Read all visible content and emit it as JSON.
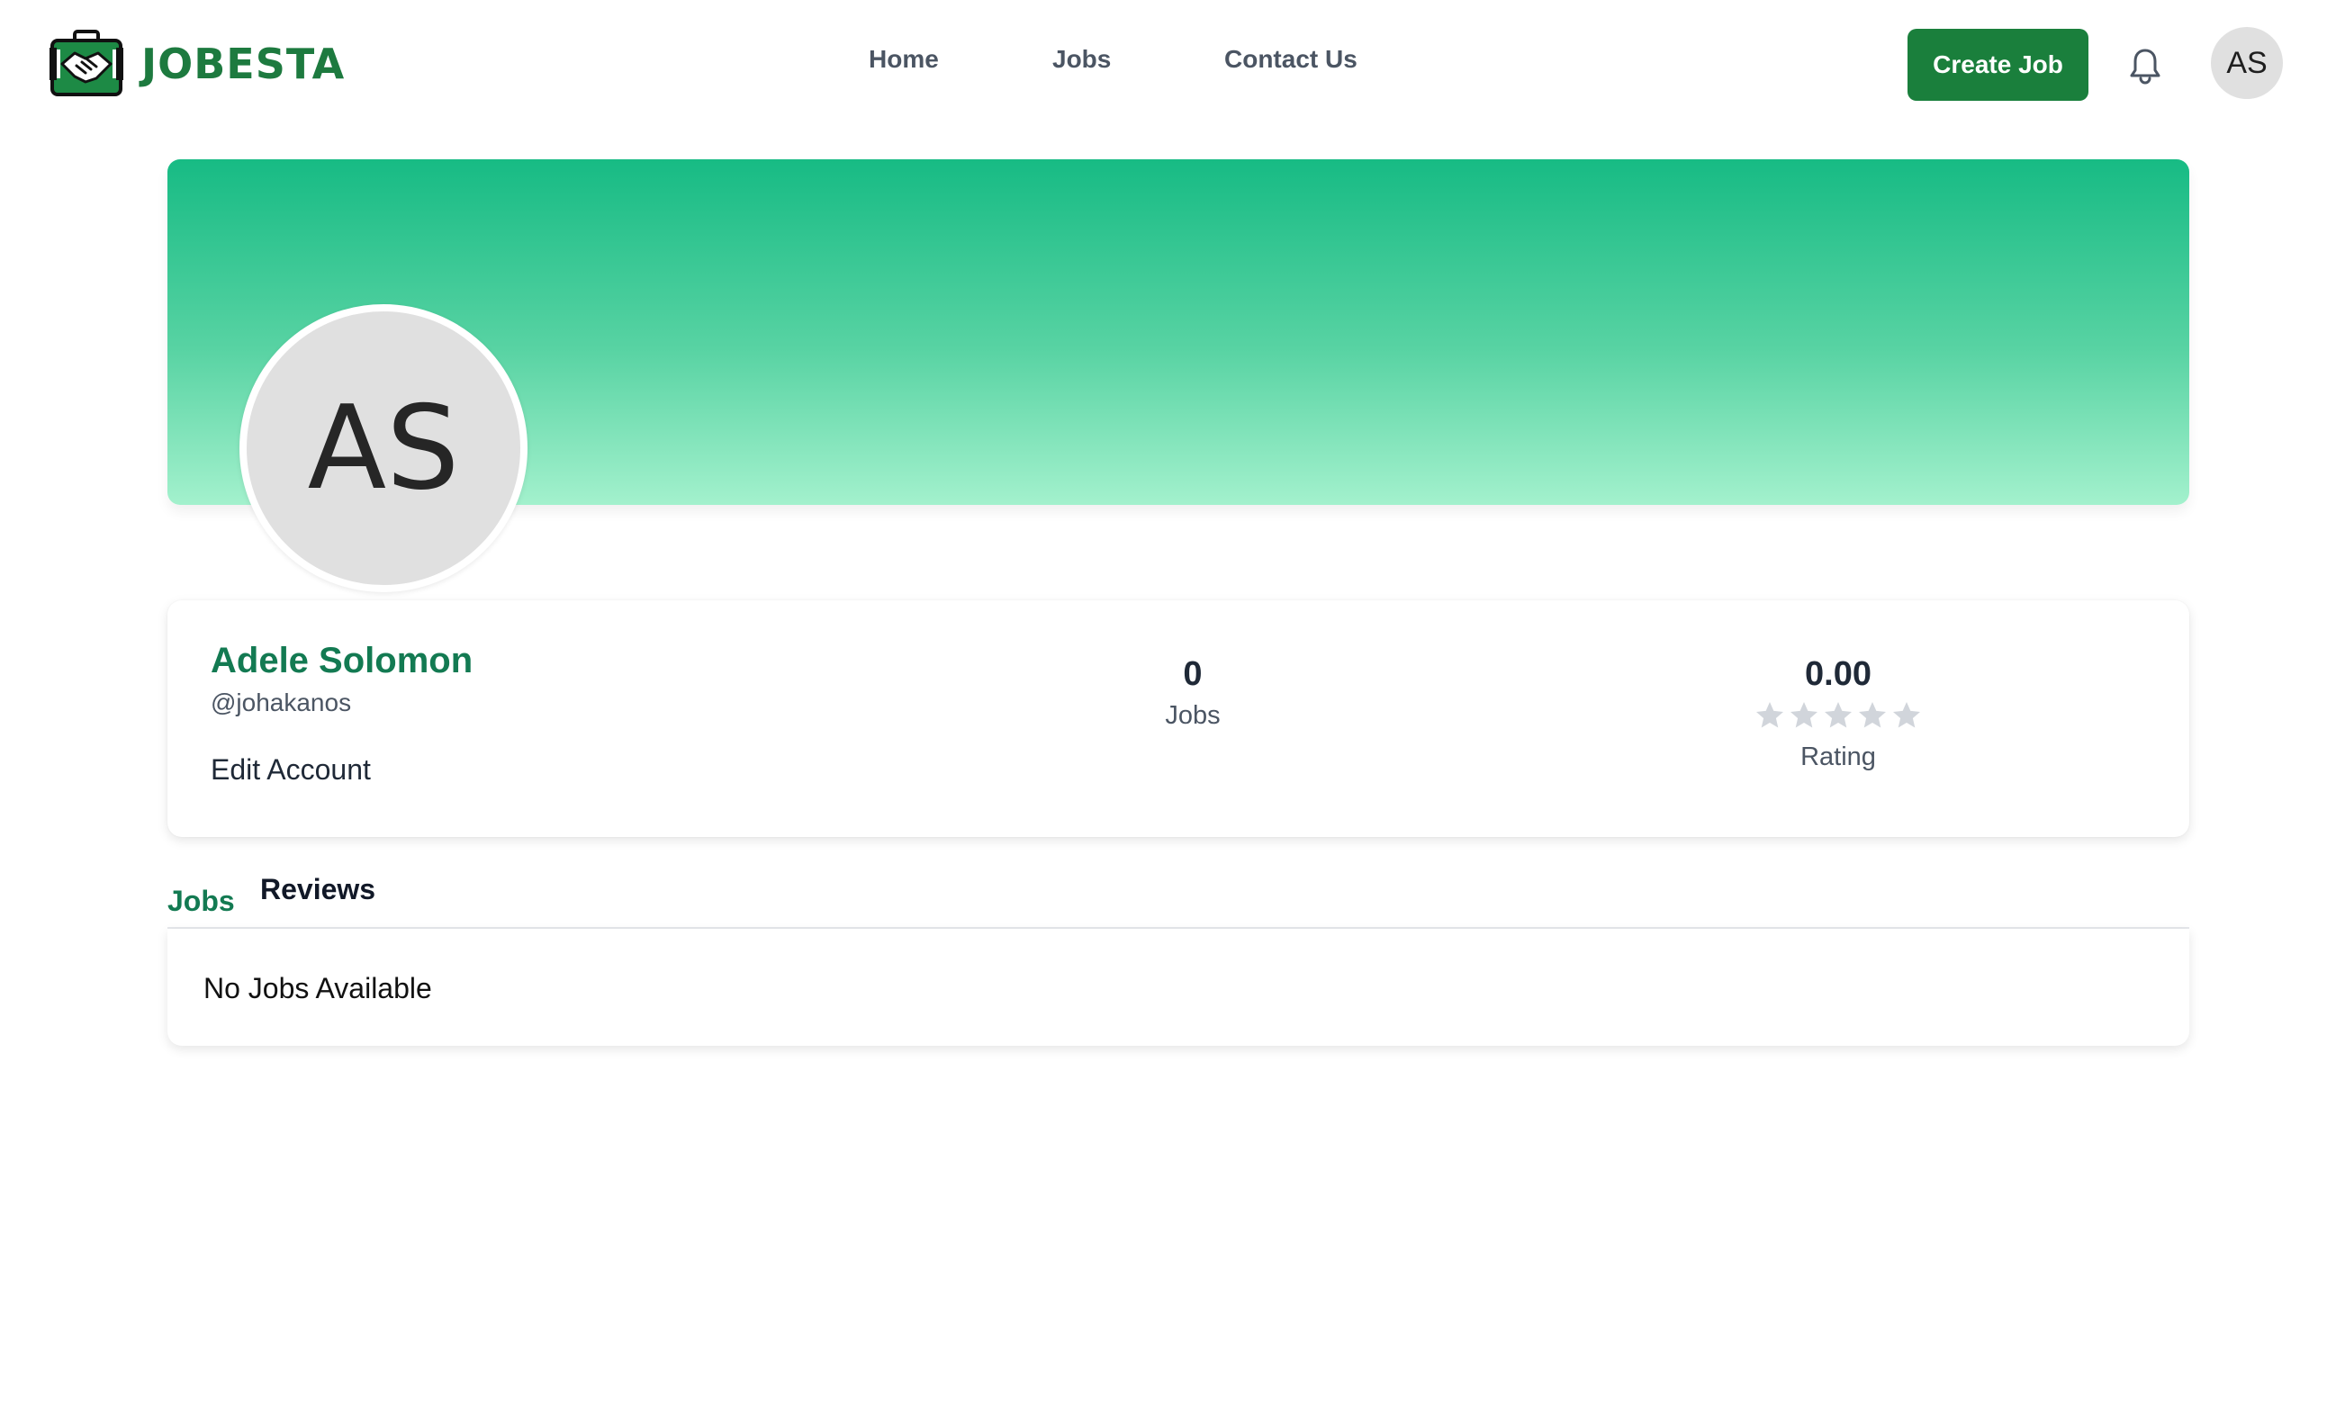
{
  "header": {
    "brand": "JOBESTA",
    "nav": [
      {
        "label": "Home"
      },
      {
        "label": "Jobs"
      },
      {
        "label": "Contact Us"
      }
    ],
    "create_job_label": "Create Job",
    "user_initials": "AS"
  },
  "profile": {
    "initials": "AS",
    "name": "Adele Solomon",
    "handle": "@johakanos",
    "edit_label": "Edit Account",
    "stats": {
      "jobs_value": "0",
      "jobs_label": "Jobs",
      "rating_value": "0.00",
      "rating_label": "Rating",
      "rating_stars_filled": 0,
      "rating_stars_total": 5
    }
  },
  "tabs": [
    {
      "label": "Jobs",
      "active": true
    },
    {
      "label": "Reviews",
      "active": false
    }
  ],
  "jobs_panel": {
    "empty_message": "No Jobs Available"
  },
  "colors": {
    "brand_green": "#1a7f3c",
    "name_green": "#137a52",
    "banner_top": "#17bb84",
    "banner_bottom": "#a3f1cd",
    "star_empty": "#d1d5db"
  }
}
